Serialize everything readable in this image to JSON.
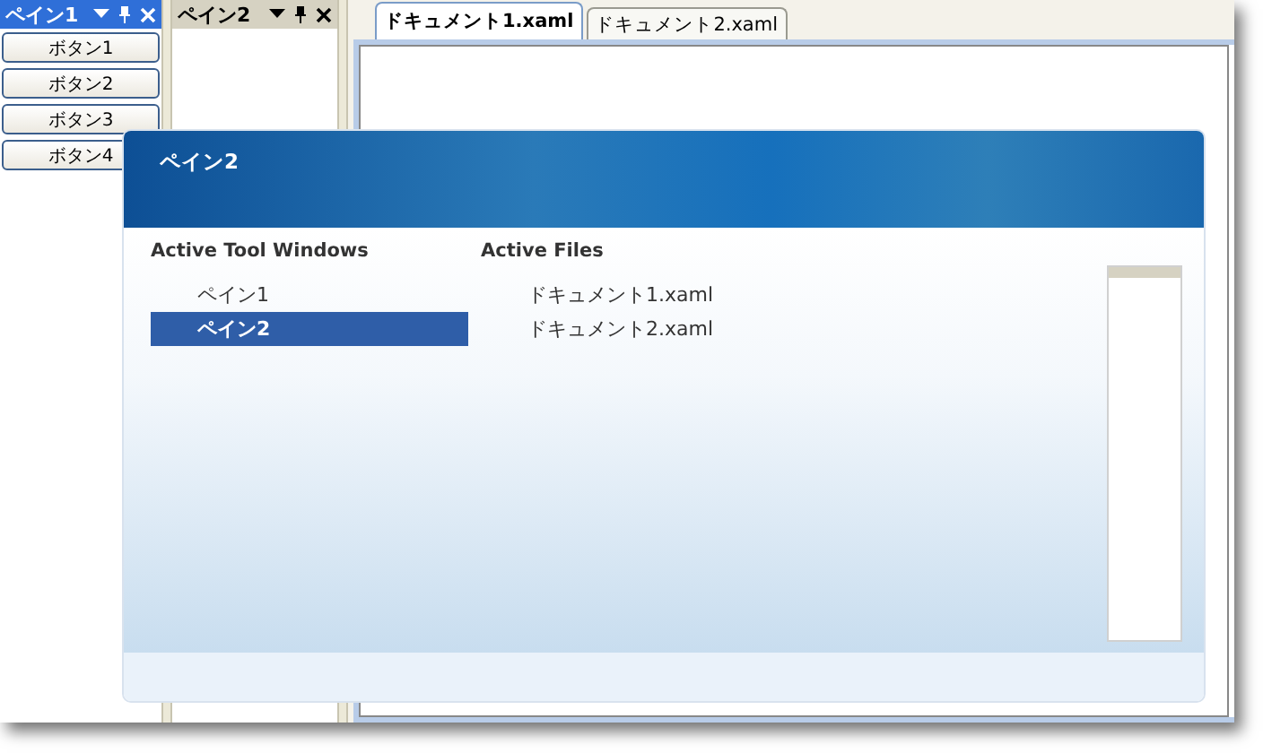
{
  "panes": [
    {
      "title": "ペイン1",
      "active": true,
      "buttons": [
        "ボタン1",
        "ボタン2",
        "ボタン3",
        "ボタン4"
      ]
    },
    {
      "title": "ペイン2",
      "active": false
    }
  ],
  "tabs": [
    {
      "label": "ドキュメント1.xaml",
      "selected": true
    },
    {
      "label": "ドキュメント2.xaml",
      "selected": false
    }
  ],
  "navigator": {
    "title": "ペイン2",
    "tool_windows": {
      "heading": "Active Tool Windows",
      "items": [
        {
          "label": "ペイン1",
          "selected": false
        },
        {
          "label": "ペイン2",
          "selected": true
        }
      ]
    },
    "files": {
      "heading": "Active Files",
      "items": [
        {
          "label": "ドキュメント1.xaml",
          "selected": false
        },
        {
          "label": "ドキュメント2.xaml",
          "selected": false
        }
      ]
    }
  }
}
